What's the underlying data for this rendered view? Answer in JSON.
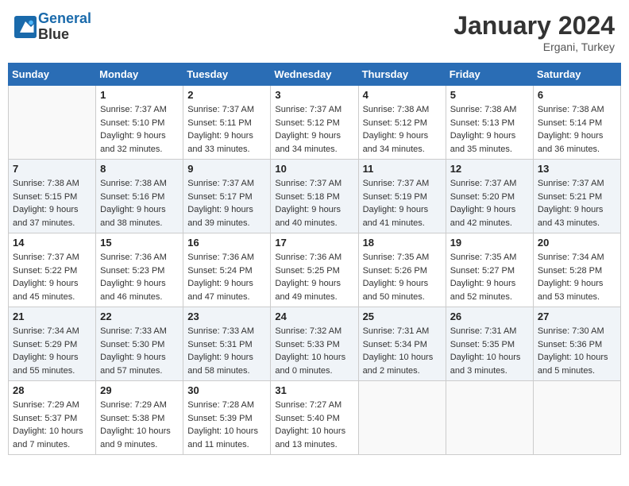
{
  "header": {
    "logo_line1": "General",
    "logo_line2": "Blue",
    "month": "January 2024",
    "location": "Ergani, Turkey"
  },
  "weekdays": [
    "Sunday",
    "Monday",
    "Tuesday",
    "Wednesday",
    "Thursday",
    "Friday",
    "Saturday"
  ],
  "weeks": [
    [
      {
        "day": "",
        "sunrise": "",
        "sunset": "",
        "daylight": ""
      },
      {
        "day": "1",
        "sunrise": "Sunrise: 7:37 AM",
        "sunset": "Sunset: 5:10 PM",
        "daylight": "Daylight: 9 hours and 32 minutes."
      },
      {
        "day": "2",
        "sunrise": "Sunrise: 7:37 AM",
        "sunset": "Sunset: 5:11 PM",
        "daylight": "Daylight: 9 hours and 33 minutes."
      },
      {
        "day": "3",
        "sunrise": "Sunrise: 7:37 AM",
        "sunset": "Sunset: 5:12 PM",
        "daylight": "Daylight: 9 hours and 34 minutes."
      },
      {
        "day": "4",
        "sunrise": "Sunrise: 7:38 AM",
        "sunset": "Sunset: 5:12 PM",
        "daylight": "Daylight: 9 hours and 34 minutes."
      },
      {
        "day": "5",
        "sunrise": "Sunrise: 7:38 AM",
        "sunset": "Sunset: 5:13 PM",
        "daylight": "Daylight: 9 hours and 35 minutes."
      },
      {
        "day": "6",
        "sunrise": "Sunrise: 7:38 AM",
        "sunset": "Sunset: 5:14 PM",
        "daylight": "Daylight: 9 hours and 36 minutes."
      }
    ],
    [
      {
        "day": "7",
        "sunrise": "Sunrise: 7:38 AM",
        "sunset": "Sunset: 5:15 PM",
        "daylight": "Daylight: 9 hours and 37 minutes."
      },
      {
        "day": "8",
        "sunrise": "Sunrise: 7:38 AM",
        "sunset": "Sunset: 5:16 PM",
        "daylight": "Daylight: 9 hours and 38 minutes."
      },
      {
        "day": "9",
        "sunrise": "Sunrise: 7:37 AM",
        "sunset": "Sunset: 5:17 PM",
        "daylight": "Daylight: 9 hours and 39 minutes."
      },
      {
        "day": "10",
        "sunrise": "Sunrise: 7:37 AM",
        "sunset": "Sunset: 5:18 PM",
        "daylight": "Daylight: 9 hours and 40 minutes."
      },
      {
        "day": "11",
        "sunrise": "Sunrise: 7:37 AM",
        "sunset": "Sunset: 5:19 PM",
        "daylight": "Daylight: 9 hours and 41 minutes."
      },
      {
        "day": "12",
        "sunrise": "Sunrise: 7:37 AM",
        "sunset": "Sunset: 5:20 PM",
        "daylight": "Daylight: 9 hours and 42 minutes."
      },
      {
        "day": "13",
        "sunrise": "Sunrise: 7:37 AM",
        "sunset": "Sunset: 5:21 PM",
        "daylight": "Daylight: 9 hours and 43 minutes."
      }
    ],
    [
      {
        "day": "14",
        "sunrise": "Sunrise: 7:37 AM",
        "sunset": "Sunset: 5:22 PM",
        "daylight": "Daylight: 9 hours and 45 minutes."
      },
      {
        "day": "15",
        "sunrise": "Sunrise: 7:36 AM",
        "sunset": "Sunset: 5:23 PM",
        "daylight": "Daylight: 9 hours and 46 minutes."
      },
      {
        "day": "16",
        "sunrise": "Sunrise: 7:36 AM",
        "sunset": "Sunset: 5:24 PM",
        "daylight": "Daylight: 9 hours and 47 minutes."
      },
      {
        "day": "17",
        "sunrise": "Sunrise: 7:36 AM",
        "sunset": "Sunset: 5:25 PM",
        "daylight": "Daylight: 9 hours and 49 minutes."
      },
      {
        "day": "18",
        "sunrise": "Sunrise: 7:35 AM",
        "sunset": "Sunset: 5:26 PM",
        "daylight": "Daylight: 9 hours and 50 minutes."
      },
      {
        "day": "19",
        "sunrise": "Sunrise: 7:35 AM",
        "sunset": "Sunset: 5:27 PM",
        "daylight": "Daylight: 9 hours and 52 minutes."
      },
      {
        "day": "20",
        "sunrise": "Sunrise: 7:34 AM",
        "sunset": "Sunset: 5:28 PM",
        "daylight": "Daylight: 9 hours and 53 minutes."
      }
    ],
    [
      {
        "day": "21",
        "sunrise": "Sunrise: 7:34 AM",
        "sunset": "Sunset: 5:29 PM",
        "daylight": "Daylight: 9 hours and 55 minutes."
      },
      {
        "day": "22",
        "sunrise": "Sunrise: 7:33 AM",
        "sunset": "Sunset: 5:30 PM",
        "daylight": "Daylight: 9 hours and 57 minutes."
      },
      {
        "day": "23",
        "sunrise": "Sunrise: 7:33 AM",
        "sunset": "Sunset: 5:31 PM",
        "daylight": "Daylight: 9 hours and 58 minutes."
      },
      {
        "day": "24",
        "sunrise": "Sunrise: 7:32 AM",
        "sunset": "Sunset: 5:33 PM",
        "daylight": "Daylight: 10 hours and 0 minutes."
      },
      {
        "day": "25",
        "sunrise": "Sunrise: 7:31 AM",
        "sunset": "Sunset: 5:34 PM",
        "daylight": "Daylight: 10 hours and 2 minutes."
      },
      {
        "day": "26",
        "sunrise": "Sunrise: 7:31 AM",
        "sunset": "Sunset: 5:35 PM",
        "daylight": "Daylight: 10 hours and 3 minutes."
      },
      {
        "day": "27",
        "sunrise": "Sunrise: 7:30 AM",
        "sunset": "Sunset: 5:36 PM",
        "daylight": "Daylight: 10 hours and 5 minutes."
      }
    ],
    [
      {
        "day": "28",
        "sunrise": "Sunrise: 7:29 AM",
        "sunset": "Sunset: 5:37 PM",
        "daylight": "Daylight: 10 hours and 7 minutes."
      },
      {
        "day": "29",
        "sunrise": "Sunrise: 7:29 AM",
        "sunset": "Sunset: 5:38 PM",
        "daylight": "Daylight: 10 hours and 9 minutes."
      },
      {
        "day": "30",
        "sunrise": "Sunrise: 7:28 AM",
        "sunset": "Sunset: 5:39 PM",
        "daylight": "Daylight: 10 hours and 11 minutes."
      },
      {
        "day": "31",
        "sunrise": "Sunrise: 7:27 AM",
        "sunset": "Sunset: 5:40 PM",
        "daylight": "Daylight: 10 hours and 13 minutes."
      },
      {
        "day": "",
        "sunrise": "",
        "sunset": "",
        "daylight": ""
      },
      {
        "day": "",
        "sunrise": "",
        "sunset": "",
        "daylight": ""
      },
      {
        "day": "",
        "sunrise": "",
        "sunset": "",
        "daylight": ""
      }
    ]
  ]
}
